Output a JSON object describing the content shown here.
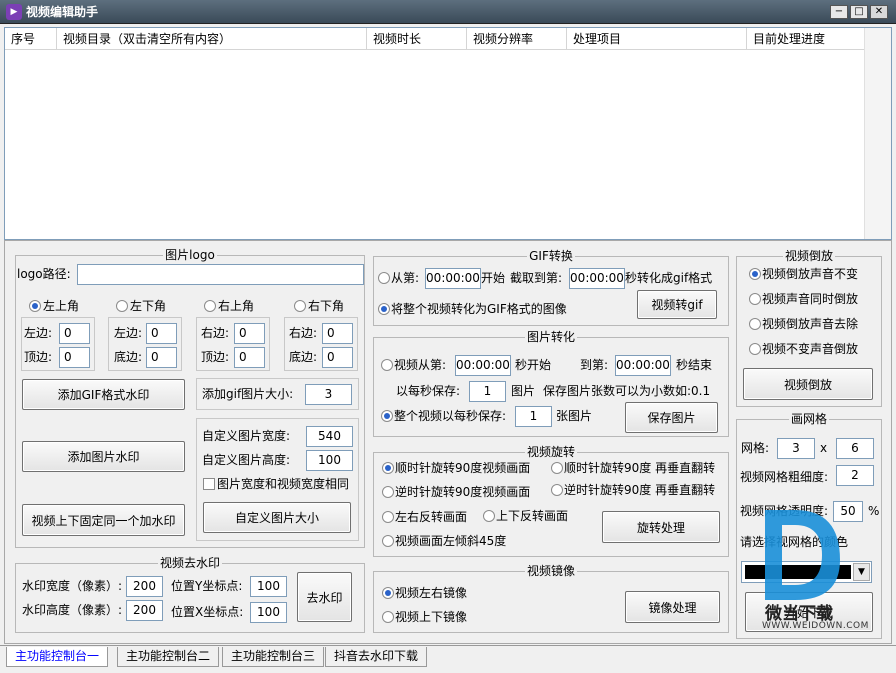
{
  "window": {
    "title": "视频编辑助手",
    "icon": "play-icon",
    "min": "−",
    "max": "□",
    "close": "✕"
  },
  "list": {
    "columns": [
      "序号",
      "视频目录（双击清空所有内容）",
      "视频时长",
      "视频分辨率",
      "处理项目",
      "目前处理进度"
    ]
  },
  "logo": {
    "title": "图片logo",
    "path_label": "logo路径:",
    "path_value": "",
    "corners": [
      "左上角",
      "左下角",
      "右上角",
      "右下角"
    ],
    "left": "左边:",
    "top": "顶边:",
    "right": "右边:",
    "bottom": "底边:",
    "zero": "0",
    "add_gif": "添加GIF格式水印",
    "add_img": "添加图片水印",
    "fixed": "视频上下固定同一个加水印",
    "gif_size_label": "添加gif图片大小:",
    "gif_size": "3",
    "w_label": "自定义图片宽度:",
    "w": "540",
    "h_label": "自定义图片高度:",
    "h": "100",
    "same_w": "图片宽度和视频宽度相同",
    "custom_btn": "自定义图片大小"
  },
  "remove": {
    "title": "视频去水印",
    "w_label": "水印宽度（像素）:",
    "w": "200",
    "h_label": "水印高度（像素）:",
    "h": "200",
    "y_label": "位置Y坐标点:",
    "y": "100",
    "x_label": "位置X坐标点:",
    "x": "100",
    "btn": "去水印"
  },
  "gif": {
    "title": "GIF转换",
    "from": "从第:",
    "t1": "00:00:00",
    "start": "开始",
    "cut_to": "截取到第:",
    "t2": "00:00:00",
    "sec_to": "秒转化成gif格式",
    "whole": "将整个视频转化为GIF格式的图像",
    "btn": "视频转gif"
  },
  "pic": {
    "title": "图片转化",
    "from": "视频从第:",
    "t1": "00:00:00",
    "sec_start": "秒开始",
    "to": "到第:",
    "t2": "00:00:00",
    "sec_end": "秒结束",
    "per_sec": "以每秒保存:",
    "n1": "1",
    "pics": "图片",
    "note": "保存图片张数可以为小数如:0.1",
    "whole": "整个视频以每秒保存:",
    "n2": "1",
    "pics2": "张图片",
    "btn": "保存图片"
  },
  "rotate": {
    "title": "视频旋转",
    "cw": "顺时针旋转90度视频画面",
    "cw_v": "顺时针旋转90度 再垂直翻转",
    "ccw": "逆时针旋转90度视频画面",
    "ccw_v": "逆时针旋转90度 再垂直翻转",
    "lr": "左右反转画面",
    "ud": "上下反转画面",
    "tilt": "视频画面左倾斜45度",
    "btn": "旋转处理"
  },
  "mirror": {
    "title": "视频镜像",
    "lr": "视频左右镜像",
    "ud": "视频上下镜像",
    "btn": "镜像处理"
  },
  "reverse": {
    "title": "视频倒放",
    "o1": "视频倒放声音不变",
    "o2": "视频声音同时倒放",
    "o3": "视频倒放声音去除",
    "o4": "视频不变声音倒放",
    "btn": "视频倒放"
  },
  "grid": {
    "title": "画网格",
    "grid_label": "网格:",
    "g1": "3",
    "x": "x",
    "g2": "6",
    "thick_label": "视频网格粗细度:",
    "thick": "2",
    "alpha_label": "视频网格透明度:",
    "alpha": "50",
    "pct": "%",
    "color_label": "请选择视网格的颜色",
    "color": "#000000",
    "btn": "开始下载"
  },
  "tabs": [
    "主功能控制台一",
    "主功能控制台二",
    "主功能控制台三",
    "抖音去水印下载"
  ],
  "watermark": {
    "brand": "微当下载",
    "url": "WWW.WEIDOWN.COM",
    "color": "#1a8fd8"
  }
}
